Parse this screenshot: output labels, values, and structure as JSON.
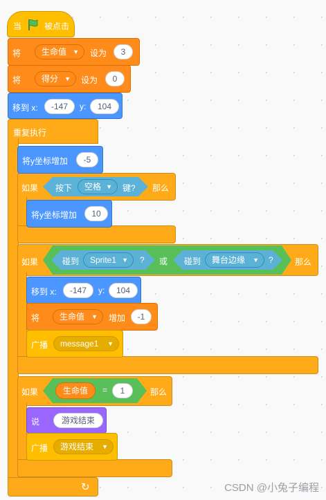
{
  "hat": {
    "when": "当",
    "clicked": "被点击",
    "flag_color": "#4CBF56"
  },
  "set_life": {
    "verb": "将",
    "var": "生命值",
    "to": "设为",
    "value": "3"
  },
  "set_score": {
    "verb": "将",
    "var": "得分",
    "to": "设为",
    "value": "0"
  },
  "goto1": {
    "label": "移到 x:",
    "x": "-147",
    "ylabel": "y:",
    "y": "104"
  },
  "forever": {
    "label": "重复执行"
  },
  "change_y1": {
    "label": "将y坐标增加",
    "value": "-5"
  },
  "if_key": {
    "if": "如果",
    "press": "按下",
    "key": "空格",
    "key_suffix": "键?",
    "then": "那么"
  },
  "change_y2": {
    "label": "将y坐标增加",
    "value": "10"
  },
  "if_touch": {
    "if": "如果",
    "touch1": "碰到",
    "sprite": "Sprite1",
    "q1": "?",
    "or": "或",
    "touch2": "碰到",
    "edge": "舞台边缘",
    "q2": "?",
    "then": "那么"
  },
  "goto2": {
    "label": "移到 x:",
    "x": "-147",
    "ylabel": "y:",
    "y": "104"
  },
  "change_life": {
    "verb": "将",
    "var": "生命值",
    "by": "增加",
    "value": "-1"
  },
  "bcast1": {
    "label": "广播",
    "msg": "message1"
  },
  "if_life": {
    "if": "如果",
    "var": "生命值",
    "eq": "=",
    "value": "1",
    "then": "那么"
  },
  "say": {
    "label": "说",
    "text": "游戏结束"
  },
  "bcast2": {
    "label": "广播",
    "msg": "游戏结束"
  },
  "loop_arrow": "↻",
  "watermark": "CSDN @小兔子编程",
  "colors": {
    "events": "#FFBF00",
    "control": "#FFAB19",
    "variables": "#FF8C1A",
    "motion": "#4C97FF",
    "looks": "#9966FF",
    "sensing": "#5CB1D6",
    "operators": "#59C059"
  }
}
